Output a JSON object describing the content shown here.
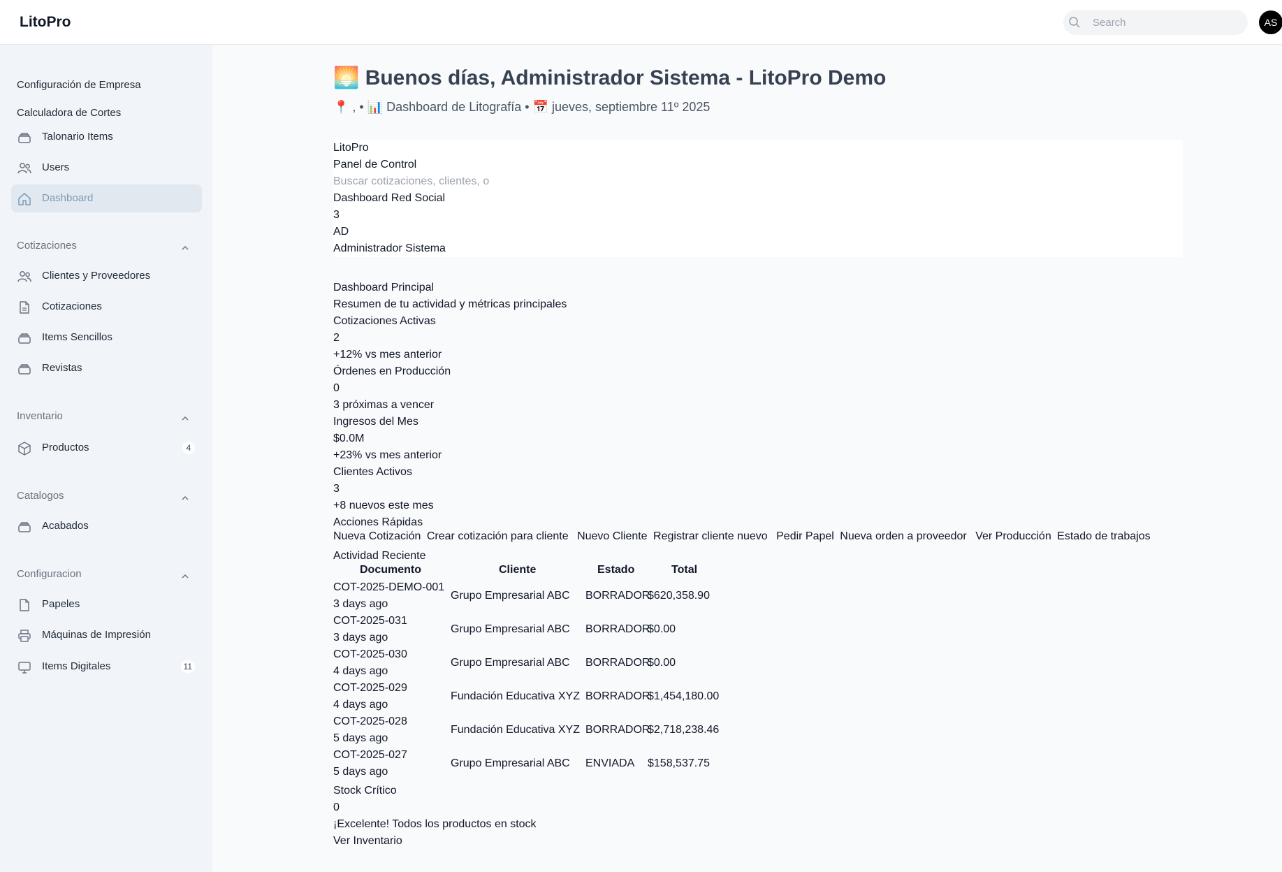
{
  "app": {
    "brand": "LitoPro",
    "search_placeholder": "Search",
    "avatar_initials": "AS"
  },
  "sidebar": {
    "top_items": [
      {
        "label": "Configuración de Empresa",
        "icon": "none"
      },
      {
        "label": "Calculadora de Cortes",
        "icon": "none"
      },
      {
        "label": "Talonario Items",
        "icon": "stack-icon"
      },
      {
        "label": "Users",
        "icon": "users-icon"
      },
      {
        "label": "Dashboard",
        "icon": "home-icon",
        "active": true
      }
    ],
    "groups": [
      {
        "title": "Cotizaciones",
        "items": [
          {
            "label": "Clientes y Proveedores",
            "icon": "users-icon"
          },
          {
            "label": "Cotizaciones",
            "icon": "document-icon"
          },
          {
            "label": "Items Sencillos",
            "icon": "stack-icon"
          },
          {
            "label": "Revistas",
            "icon": "stack-icon"
          }
        ]
      },
      {
        "title": "Inventario",
        "items": [
          {
            "label": "Productos",
            "icon": "cube-icon",
            "badge": "4"
          }
        ]
      },
      {
        "title": "Catalogos",
        "items": [
          {
            "label": "Acabados",
            "icon": "stack-icon"
          }
        ]
      },
      {
        "title": "Configuracion",
        "items": [
          {
            "label": "Papeles",
            "icon": "document-icon"
          },
          {
            "label": "Máquinas de Impresión",
            "icon": "printer-icon"
          },
          {
            "label": "Items Digitales",
            "icon": "monitor-icon",
            "badge": "11"
          }
        ]
      }
    ]
  },
  "header": {
    "title": "🌅 Buenos días, Administrador Sistema - LitoPro Demo",
    "subtitle": "📍 , • 📊 Dashboard de Litografía • 📅 jueves, septiembre 11º 2025"
  },
  "embedded_nav": {
    "brand": "LitoPro",
    "panel": "Panel de Control",
    "search_placeholder": "Buscar cotizaciones, clientes, o",
    "social": "Dashboard Red Social",
    "notifications": "3",
    "initials": "AD",
    "user_name": "Administrador Sistema"
  },
  "dashboard": {
    "title": "Dashboard Principal",
    "subtitle": "Resumen de tu actividad y métricas principales",
    "metrics": [
      {
        "label": "Cotizaciones Activas",
        "value": "2",
        "note": "+12% vs mes anterior"
      },
      {
        "label": "Órdenes en Producción",
        "value": "0",
        "note": "3 próximas a vencer"
      },
      {
        "label": "Ingresos del Mes",
        "value": "$0.0M",
        "note": "+23% vs mes anterior"
      },
      {
        "label": "Clientes Activos",
        "value": "3",
        "note": "+8 nuevos este mes"
      }
    ],
    "quick_actions_title": "Acciones Rápidas",
    "quick_actions": [
      {
        "label": "Nueva Cotización",
        "desc": "Crear cotización para cliente"
      },
      {
        "label": "Nuevo Cliente",
        "desc": "Registrar cliente nuevo"
      },
      {
        "label": "Pedir Papel",
        "desc": "Nueva orden a proveedor"
      },
      {
        "label": "Ver Producción",
        "desc": "Estado de trabajos"
      }
    ],
    "activity_title": "Actividad Reciente",
    "table": {
      "headers": [
        "Documento",
        "Cliente",
        "Estado",
        "Total"
      ],
      "rows": [
        {
          "doc": "COT-2025-DEMO-001",
          "ago": "3 days ago",
          "client": "Grupo Empresarial ABC",
          "status": "BORRADOR",
          "total": "$620,358.90"
        },
        {
          "doc": "COT-2025-031",
          "ago": "3 days ago",
          "client": "Grupo Empresarial ABC",
          "status": "BORRADOR",
          "total": "$0.00"
        },
        {
          "doc": "COT-2025-030",
          "ago": "4 days ago",
          "client": "Grupo Empresarial ABC",
          "status": "BORRADOR",
          "total": "$0.00"
        },
        {
          "doc": "COT-2025-029",
          "ago": "4 days ago",
          "client": "Fundación Educativa XYZ",
          "status": "BORRADOR",
          "total": "$1,454,180.00"
        },
        {
          "doc": "COT-2025-028",
          "ago": "5 days ago",
          "client": "Fundación Educativa XYZ",
          "status": "BORRADOR",
          "total": "$2,718,238.46"
        },
        {
          "doc": "COT-2025-027",
          "ago": "5 days ago",
          "client": "Grupo Empresarial ABC",
          "status": "ENVIADA",
          "total": "$158,537.75"
        }
      ]
    },
    "stock_title": "Stock Crítico",
    "stock_value": "0",
    "stock_message": "¡Excelente! Todos los productos en stock",
    "stock_link": "Ver Inventario"
  }
}
